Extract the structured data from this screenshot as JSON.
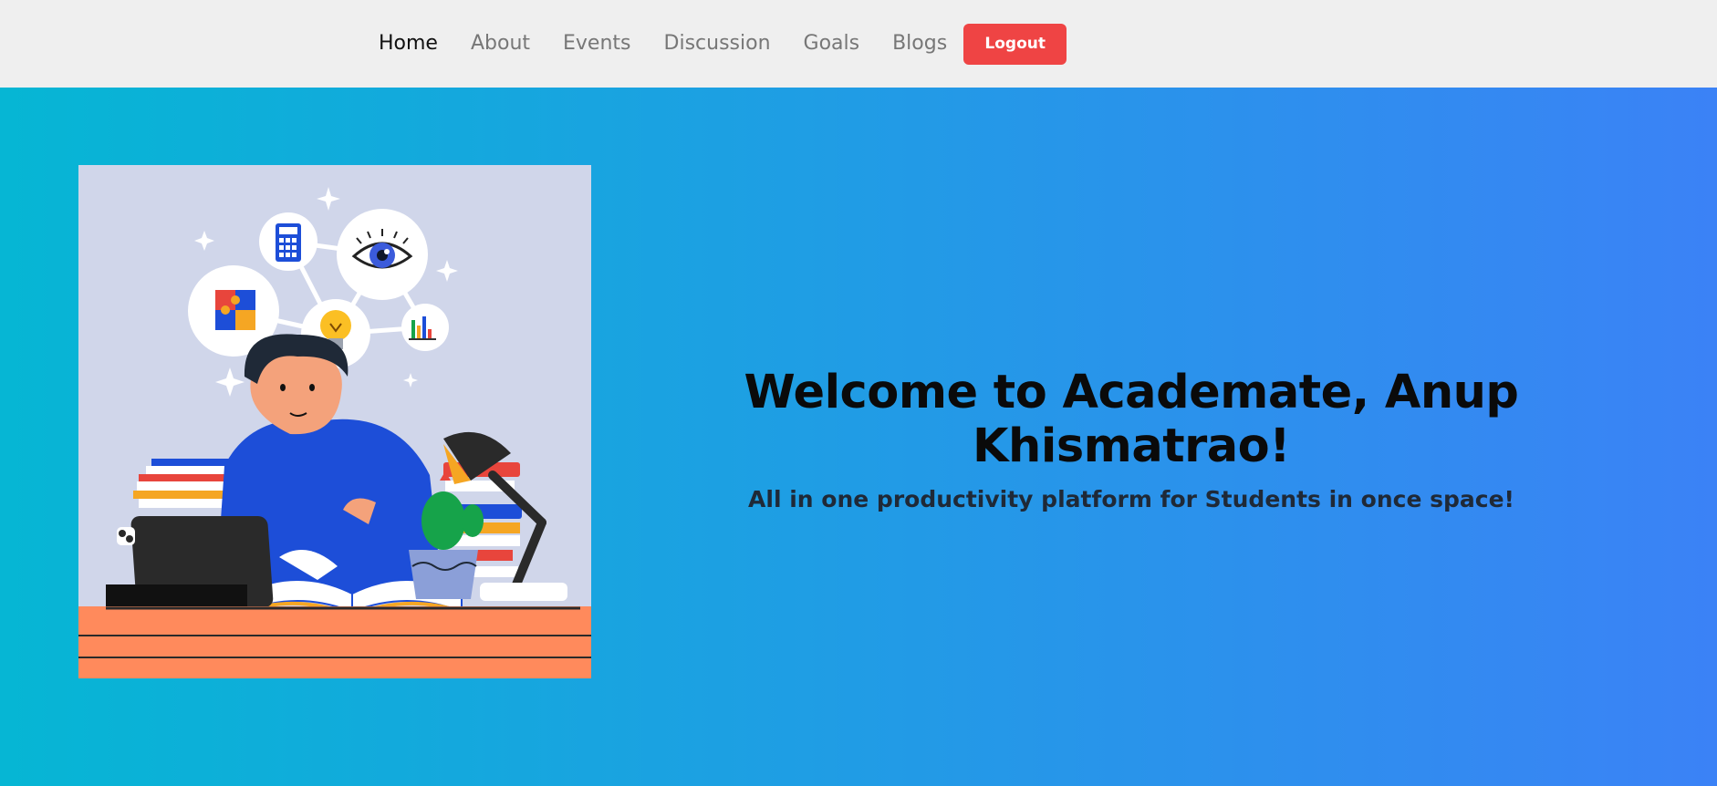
{
  "nav": {
    "links": [
      {
        "label": "Home",
        "active": true
      },
      {
        "label": "About"
      },
      {
        "label": "Events"
      },
      {
        "label": "Discussion"
      },
      {
        "label": "Goals"
      },
      {
        "label": "Blogs"
      }
    ],
    "logout_label": "Logout"
  },
  "hero": {
    "title": "Welcome to Academate, Anup Khismatrao!",
    "subtitle": "All in one productivity platform for Students in once space!"
  },
  "colors": {
    "gradient_start": "#06b6d4",
    "gradient_end": "#3b82f6",
    "logout": "#ef4444",
    "navbar_bg": "#efefef"
  }
}
